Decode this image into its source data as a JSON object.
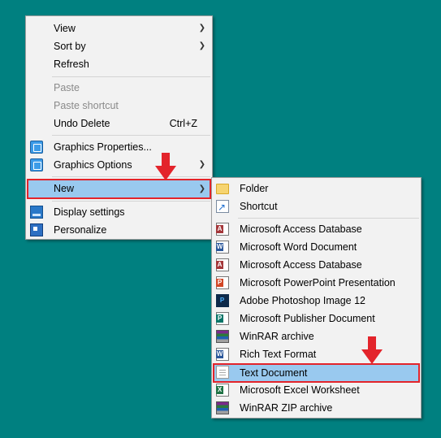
{
  "context_menu": {
    "items": [
      {
        "label": "View",
        "submenu": true
      },
      {
        "label": "Sort by",
        "submenu": true
      },
      {
        "label": "Refresh"
      },
      {
        "label": "Paste",
        "disabled": true
      },
      {
        "label": "Paste shortcut",
        "disabled": true
      },
      {
        "label": "Undo Delete",
        "shortcut": "Ctrl+Z"
      },
      {
        "label": "Graphics Properties...",
        "icon": "graphics-icon"
      },
      {
        "label": "Graphics Options",
        "icon": "graphics-icon",
        "submenu": true
      },
      {
        "label": "New",
        "submenu": true,
        "highlighted": true
      },
      {
        "label": "Display settings",
        "icon": "display-icon"
      },
      {
        "label": "Personalize",
        "icon": "personalize-icon"
      }
    ]
  },
  "new_submenu": {
    "items": [
      {
        "label": "Folder",
        "icon": "folder-icon"
      },
      {
        "label": "Shortcut",
        "icon": "shortcut-icon"
      },
      {
        "label": "Microsoft Access Database",
        "icon": "access-icon"
      },
      {
        "label": "Microsoft Word Document",
        "icon": "word-icon"
      },
      {
        "label": "Microsoft Access Database",
        "icon": "access-icon"
      },
      {
        "label": "Microsoft PowerPoint Presentation",
        "icon": "powerpoint-icon"
      },
      {
        "label": "Adobe Photoshop Image 12",
        "icon": "photoshop-icon"
      },
      {
        "label": "Microsoft Publisher Document",
        "icon": "publisher-icon"
      },
      {
        "label": "WinRAR archive",
        "icon": "winrar-icon"
      },
      {
        "label": "Rich Text Format",
        "icon": "wordpad-icon"
      },
      {
        "label": "Text Document",
        "icon": "text-document-icon",
        "highlighted": true
      },
      {
        "label": "Microsoft Excel Worksheet",
        "icon": "excel-icon"
      },
      {
        "label": "WinRAR ZIP archive",
        "icon": "winrar-zip-icon"
      }
    ]
  },
  "colors": {
    "desktop": "#008080",
    "menu_bg": "#f2f2f2",
    "highlight": "#99c9ef",
    "annotation_red": "#e3242b"
  },
  "annotations": [
    "red-down-arrow",
    "red-down-arrow"
  ]
}
